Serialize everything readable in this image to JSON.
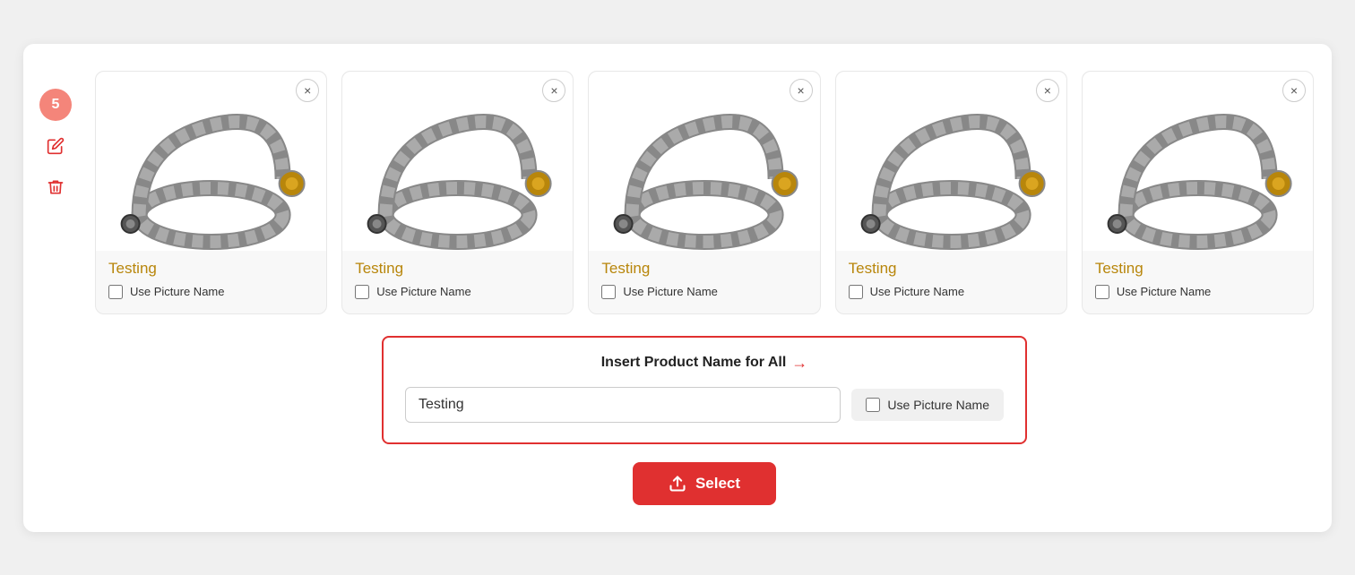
{
  "sidebar": {
    "badge": "5",
    "edit_icon": "✏",
    "delete_icon": "🗑"
  },
  "cards": [
    {
      "id": 1,
      "title": "Testing",
      "checkbox_label": "Use Picture Name",
      "checked": false
    },
    {
      "id": 2,
      "title": "Testing",
      "checkbox_label": "Use Picture Name",
      "checked": false
    },
    {
      "id": 3,
      "title": "Testing",
      "checkbox_label": "Use Picture Name",
      "checked": false
    },
    {
      "id": 4,
      "title": "Testing",
      "checkbox_label": "Use Picture Name",
      "checked": false
    },
    {
      "id": 5,
      "title": "Testing",
      "checkbox_label": "Use Picture Name",
      "checked": false
    }
  ],
  "insert_panel": {
    "title": "Insert Product Name for All",
    "input_value": "Testing",
    "checkbox_label": "Use Picture Name",
    "checked": false
  },
  "select_button": {
    "label": "Select"
  },
  "colors": {
    "accent_red": "#e03030",
    "title_gold": "#b8860b",
    "close_x": "×"
  }
}
